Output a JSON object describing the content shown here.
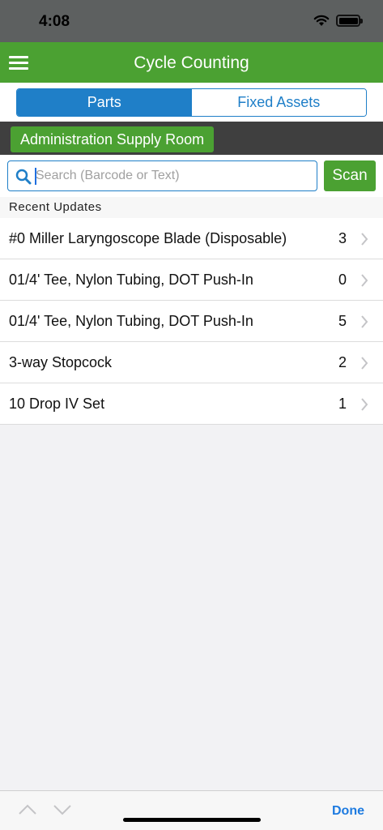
{
  "status_bar": {
    "time": "4:08"
  },
  "nav": {
    "title": "Cycle Counting"
  },
  "segments": [
    {
      "label": "Parts",
      "active": true
    },
    {
      "label": "Fixed Assets",
      "active": false
    }
  ],
  "location": {
    "label": "Administration Supply Room"
  },
  "search": {
    "placeholder": "Search (Barcode or Text)",
    "value": "",
    "scan_label": "Scan"
  },
  "recent": {
    "header": "Recent Updates",
    "items": [
      {
        "label": "#0 Miller Laryngoscope Blade (Disposable)",
        "count": "3"
      },
      {
        "label": "01/4' Tee, Nylon Tubing, DOT Push-In",
        "count": "0"
      },
      {
        "label": "01/4' Tee, Nylon Tubing, DOT Push-In",
        "count": "5"
      },
      {
        "label": "3-way Stopcock",
        "count": "2"
      },
      {
        "label": "10 Drop IV Set",
        "count": "1"
      }
    ]
  },
  "toolbar": {
    "done_label": "Done"
  },
  "colors": {
    "brand_green": "#4ba132",
    "accent_blue": "#1f7fc8",
    "link_blue": "#1e7be0",
    "location_bar": "#3f3f3f"
  }
}
